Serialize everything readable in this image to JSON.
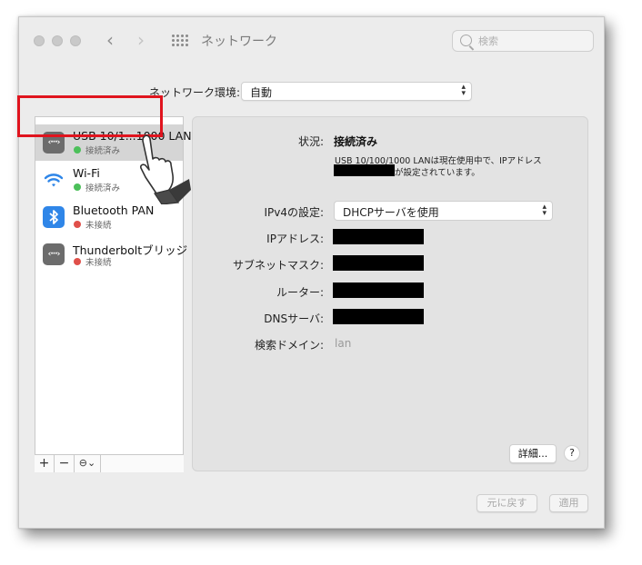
{
  "window": {
    "title": "ネットワーク",
    "search_placeholder": "検索"
  },
  "location": {
    "label": "ネットワーク環境:",
    "value": "自動"
  },
  "services": [
    {
      "name": "USB 10/1...1000 LAN",
      "status": "接続済み",
      "status_color": "#4cc05a",
      "icon": "ethernet-icon",
      "selected": true
    },
    {
      "name": "Wi-Fi",
      "status": "接続済み",
      "status_color": "#4cc05a",
      "icon": "wifi-icon",
      "selected": false
    },
    {
      "name": "Bluetooth PAN",
      "status": "未接続",
      "status_color": "#e0504a",
      "icon": "bluetooth-icon",
      "selected": false
    },
    {
      "name": "Thunderboltブリッジ",
      "status": "未接続",
      "status_color": "#e0504a",
      "icon": "ethernet-icon",
      "selected": false
    }
  ],
  "sidebar_footer": {
    "add": "+",
    "remove": "−",
    "action": "⊖⌄"
  },
  "detail": {
    "status_label": "状況:",
    "status_value": "接続済み",
    "status_desc_line1": "USB 10/100/1000 LANは現在使用中で、IPアドレス",
    "status_desc_line2": "が設定されています。",
    "ipv4_label": "IPv4の設定:",
    "ipv4_value": "DHCPサーバを使用",
    "ip_label": "IPアドレス:",
    "subnet_label": "サブネットマスク:",
    "router_label": "ルーター:",
    "dns_label": "DNSサーバ:",
    "search_domain_label": "検索ドメイン:",
    "search_domain_value": "lan",
    "advanced_button": "詳細...",
    "help_button": "?"
  },
  "footer": {
    "revert_button": "元に戻す",
    "apply_button": "適用"
  },
  "colors": {
    "highlight": "#e0141e",
    "bluetooth": "#2f86e8",
    "connected": "#4cc05a",
    "disconnected": "#e0504a"
  }
}
